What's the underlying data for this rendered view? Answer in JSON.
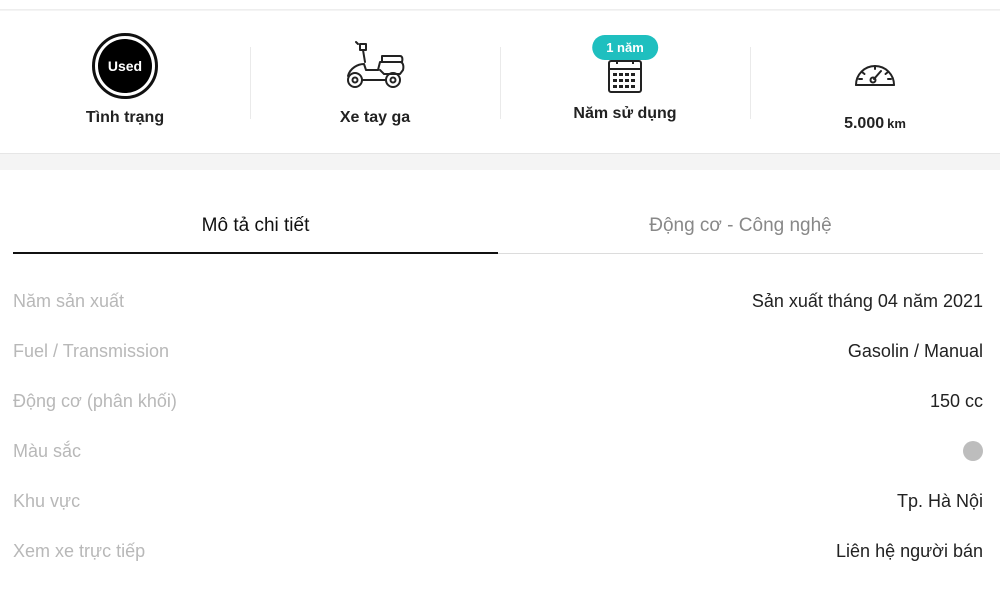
{
  "summary": {
    "condition": {
      "badge": "Used",
      "label": "Tình trạng"
    },
    "type": {
      "label": "Xe tay ga"
    },
    "years": {
      "pill": "1 năm",
      "label": "Năm sử dụng"
    },
    "mileage": {
      "value": "5.000",
      "unit": "km"
    }
  },
  "tabs": [
    {
      "label": "Mô tả chi tiết",
      "active": true
    },
    {
      "label": "Động cơ - Công nghệ",
      "active": false
    }
  ],
  "specs": [
    {
      "label": "Năm sản xuất",
      "value": "Sản xuất tháng 04 năm 2021"
    },
    {
      "label": "Fuel / Transmission",
      "value": "Gasolin / Manual"
    },
    {
      "label": "Động cơ (phân khối)",
      "value": "150 cc"
    },
    {
      "label": "Màu sắc",
      "color": "#bdbdbd"
    },
    {
      "label": "Khu vực",
      "value": "Tp. Hà Nội"
    },
    {
      "label": "Xem xe trực tiếp",
      "value": "Liên hệ người bán"
    }
  ],
  "colors": {
    "accent": "#1fbfbf",
    "label_gray": "#b8b8b8"
  }
}
